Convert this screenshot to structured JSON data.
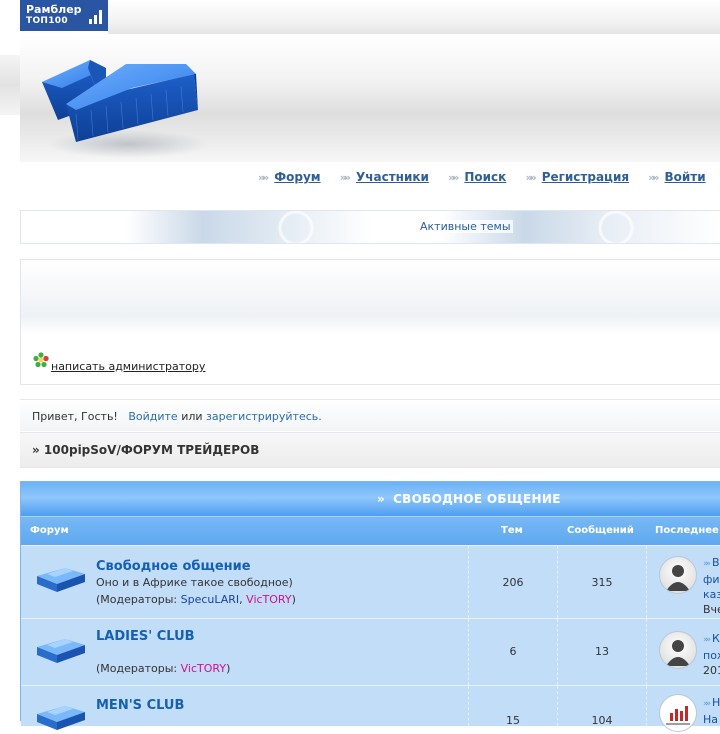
{
  "rambler": {
    "line1": "Рамблер",
    "line2": "ТОП100"
  },
  "nav": [
    {
      "label": "Форум"
    },
    {
      "label": "Участники"
    },
    {
      "label": "Поиск"
    },
    {
      "label": "Регистрация"
    },
    {
      "label": "Войти"
    }
  ],
  "nav_arrow": "»»",
  "active_topics": "Активные темы",
  "info": {
    "contact_admin": "написать администратору"
  },
  "greeting": {
    "prefix": "Привет, Гость!",
    "login": "Войдите",
    "or": "или",
    "register": "зарегистрируйтесь."
  },
  "breadcrumb": "» 100pipSoV/ФОРУМ ТРЕЙДЕРОВ",
  "category": {
    "arrow": "»",
    "title": "СВОБОДНОЕ ОБЩЕНИЕ",
    "columns": {
      "forum": "Форум",
      "topics": "Тем",
      "posts": "Сообщений",
      "last": "Последнее"
    }
  },
  "forums": [
    {
      "name": "Свободное общение",
      "desc": "Оно и в Африке такое свободное)",
      "mods_prefix": "(Модераторы: ",
      "mod1": "SpecuLARI",
      "sep": ", ",
      "mod2": "VicTORY",
      "mods_suffix": ")",
      "topics": "206",
      "posts": "315",
      "last_line1": "В",
      "last_line2": "фи",
      "last_line3": "каз",
      "last_date": "Вче"
    },
    {
      "name": "LADIES' CLUB",
      "mods_prefix": "(Модераторы: ",
      "mod2": "VicTORY",
      "mods_suffix": ")",
      "topics": "6",
      "posts": "13",
      "last_line1": "К",
      "last_line2": "пож",
      "last_date": "201"
    },
    {
      "name": "MEN'S CLUB",
      "topics": "15",
      "posts": "104",
      "last_line1": "Н",
      "last_line2": "На"
    }
  ]
}
